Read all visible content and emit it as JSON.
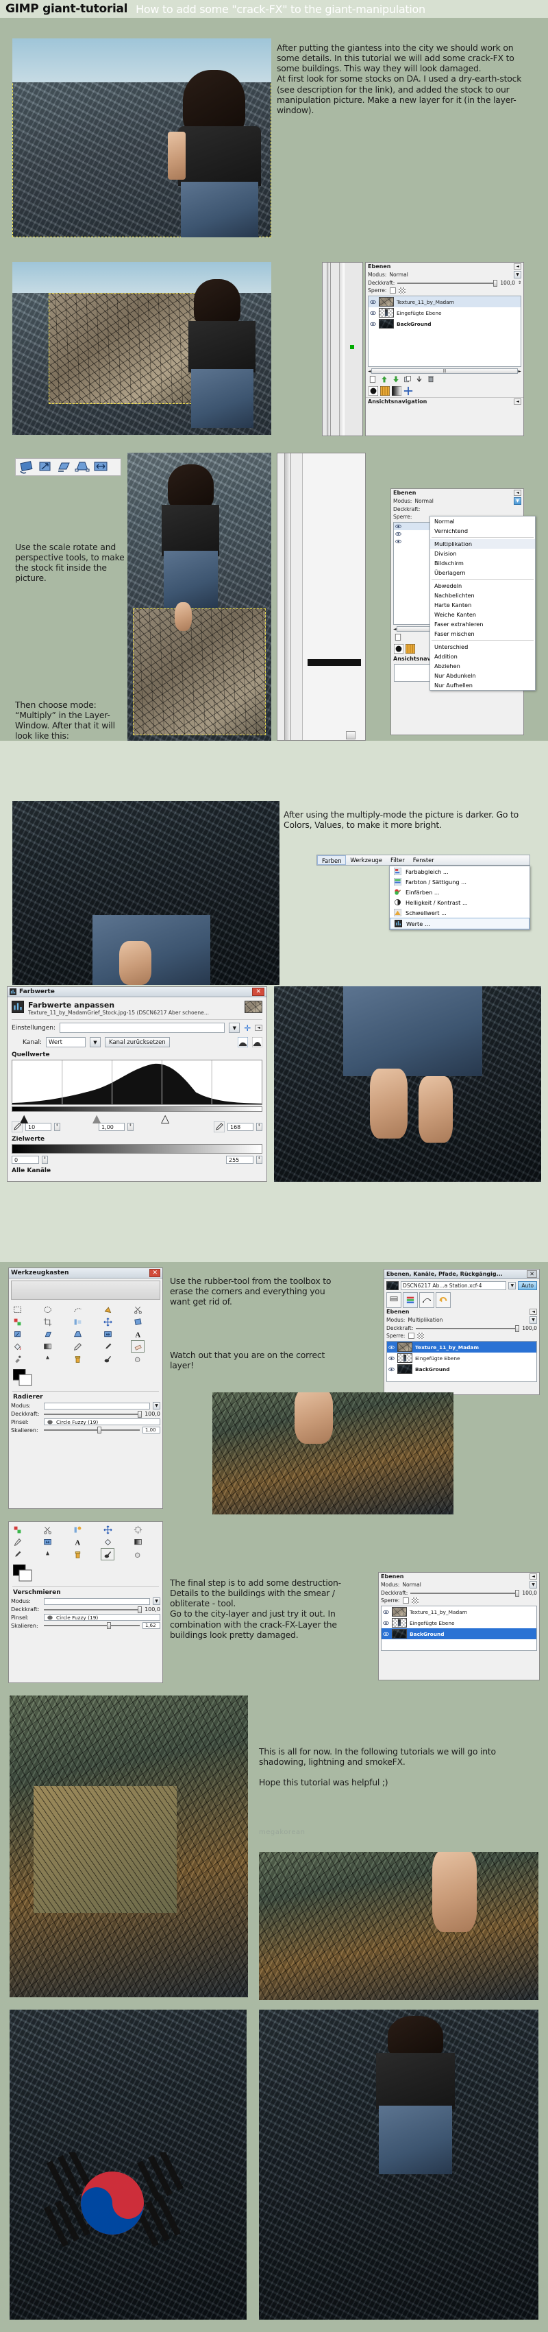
{
  "header": {
    "title": "GIMP giant-tutorial",
    "subtitle": "How to add some \"crack-FX\" to the giant-manipulation"
  },
  "steps": {
    "step1_text": "After putting the giantess into the city we should work on some details. In this tutorial we will add some crack-FX to some buildings. This way they will look damaged.\nAt first look for some stocks on DA. I used a dry-earth-stock (see description for the link), and added the stock to our manipulation picture. Make a new layer for it (in the layer-window).",
    "step3_text_a": "Use the scale rotate and perspective tools, to make the stock fit inside the picture.",
    "step3_text_b": "Then choose mode: “Multiply” in the Layer-Window. After that it will look like this:",
    "step4_text": "After using the multiply-mode the picture is darker. Go to Colors, Values, to make it more bright.",
    "step6_text_a": "Use the rubber-tool from the toolbox to erase the corners and everything you want get rid of.",
    "step6_text_b": "Watch out that you are on the correct layer!",
    "step7_text": "The final step is to add some destruction-Details to the buildings with the smear / obliterate - tool.\nGo to the city-layer and just try it out. In combination with the crack-FX-Layer the buildings look pretty damaged.",
    "outro_text": "This is all for now. In the following tutorials we will go into shadowing, lightning and smokeFX.\n\nHope this tutorial was helpful ;)",
    "watermark": "megakorean"
  },
  "layers_panel_1": {
    "dock_title": "Ebenen",
    "mode_label": "Modus:",
    "mode_value": "Normal",
    "opacity_label": "Deckkraft:",
    "opacity_value": "100,0",
    "lock_label": "Sperre:",
    "nav_title": "Ansichtsnavigation",
    "layers": [
      {
        "name": "Texture_11_by_Madam",
        "type": "texture"
      },
      {
        "name": "Eingefügte Ebene",
        "type": "figure"
      },
      {
        "name": "BackGround",
        "type": "city",
        "bold": true
      }
    ],
    "buttons": [
      "new-layer",
      "raise-layer",
      "lower-layer",
      "duplicate-layer",
      "anchor-layer",
      "delete-layer"
    ]
  },
  "layers_panel_2": {
    "dock_title": "Ebenen",
    "mode_label": "Modus:",
    "mode_value": "Normal",
    "opacity_label": "Deckkraft:",
    "lock_label": "Sperre:",
    "nav_title": "Ansichtsnavigation",
    "mode_menu": [
      "Normal",
      "Vernichtend",
      "Multiplikation",
      "Division",
      "Bildschirm",
      "Überlagern",
      "Abwedeln",
      "Nachbelichten",
      "Harte Kanten",
      "Weiche Kanten",
      "Faser extrahieren",
      "Faser mischen",
      "Unterschied",
      "Addition",
      "Abziehen",
      "Nur Abdunkeln",
      "Nur Aufhellen"
    ],
    "mode_menu_selected": "Multiplikation",
    "mode_menu_separators_after": [
      1,
      5,
      11
    ]
  },
  "colors_menu": {
    "menubar": [
      "Farben",
      "Werkzeuge",
      "Filter",
      "Fenster"
    ],
    "menubar_active": "Farben",
    "items": [
      {
        "label": "Farbabgleich ...",
        "icon": "balance-icon"
      },
      {
        "label": "Farbton / Sättigung ...",
        "icon": "hue-icon"
      },
      {
        "label": "Einfärben ...",
        "icon": "colorize-icon"
      },
      {
        "label": "Helligkeit / Kontrast ...",
        "icon": "contrast-icon"
      },
      {
        "label": "Schwellwert ...",
        "icon": "threshold-icon"
      },
      {
        "label": "Werte ...",
        "icon": "levels-icon"
      }
    ],
    "highlighted": "Werte ..."
  },
  "levels_dialog": {
    "window_title": "Farbwerte",
    "heading": "Farbwerte anpassen",
    "subheading": "Texture_11_by_MadamGrief_Stock.jpg-15 (DSCN6217 Aber schoene...",
    "settings_label": "Einstellungen:",
    "settings_value": "",
    "channel_label": "Kanal:",
    "channel_value": "Wert",
    "reset_button": "Kanal zurücksetzen",
    "source_label": "Quellwerte",
    "source_low": "10",
    "source_gamma": "1,00",
    "source_high": "168",
    "target_label": "Zielwerte",
    "target_low": "0",
    "target_high": "255",
    "all_channels_label": "Alle Kanäle"
  },
  "toolbox_1": {
    "title": "Werkzeugkasten",
    "brush_section": "Radierer",
    "mode_label": "Modus:",
    "opacity_label": "Deckkraft:",
    "opacity_value": "100,0",
    "brush_label": "Pinsel:",
    "brush_value": "Circle Fuzzy (19)",
    "scale_label": "Skalieren:",
    "scale_value": "1,00"
  },
  "toolbox_2": {
    "brush_section": "Verschmieren",
    "mode_label": "Modus:",
    "opacity_label": "Deckkraft:",
    "opacity_value": "100,0",
    "brush_label": "Pinsel:",
    "brush_value": "Circle Fuzzy (19)",
    "scale_label": "Skalieren:",
    "scale_value": "1,62"
  },
  "dock_panel": {
    "title": "Ebenen, Kanäle, Pfade, Rückgängig...",
    "image_name": "DSCN6217 Ab...a Station.xcf-4",
    "auto_button": "Auto",
    "tabs": [
      "layers-tab",
      "channels-tab",
      "paths-tab",
      "undo-tab"
    ],
    "dock_title": "Ebenen",
    "mode_label": "Modus:",
    "mode_value": "Multiplikation",
    "opacity_label": "Deckkraft:",
    "opacity_value": "100,0",
    "lock_label": "Sperre:",
    "layers": [
      {
        "name": "Texture_11_by_Madam",
        "type": "texture",
        "selected": true
      },
      {
        "name": "Eingefügte Ebene",
        "type": "figure"
      },
      {
        "name": "BackGround",
        "type": "city",
        "bold": true
      }
    ]
  },
  "layers_panel_3": {
    "dock_title": "Ebenen",
    "mode_label": "Modus:",
    "mode_value": "Normal",
    "opacity_label": "Deckkraft:",
    "opacity_value": "100,0",
    "lock_label": "Sperre:",
    "layers": [
      {
        "name": "Texture_11_by_Madam",
        "type": "texture"
      },
      {
        "name": "Eingefügte Ebene",
        "type": "figure"
      },
      {
        "name": "BackGround",
        "type": "city",
        "selected": true,
        "bold": true
      }
    ]
  },
  "transform_tools": {
    "tools": [
      "rotate-tool",
      "scale-tool",
      "shear-tool",
      "perspective-tool",
      "flip-tool"
    ]
  },
  "colors": {
    "page_bg": "#c3d0bd",
    "band_bg": "#aab9a3",
    "header_bg": "#d7e0d1",
    "annotation_red": "#e81717",
    "selection_blue": "#2a72d4"
  }
}
